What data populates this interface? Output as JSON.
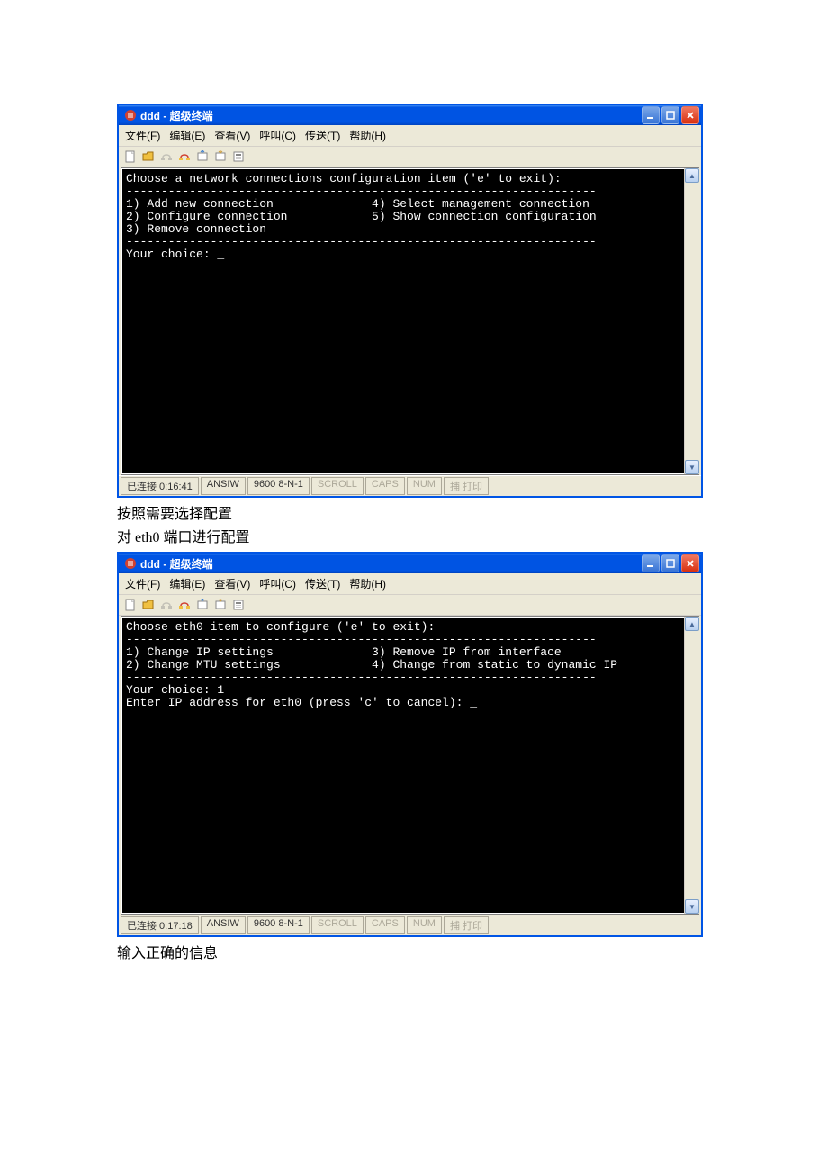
{
  "window1": {
    "title": "ddd - 超级终端",
    "menu": {
      "file": "文件(F)",
      "edit": "编辑(E)",
      "view": "查看(V)",
      "call": "呼叫(C)",
      "transfer": "传送(T)",
      "help": "帮助(H)"
    },
    "terminal": {
      "header": "Choose a network connections configuration item ('e' to exit):",
      "divider1": "-------------------------------------------------------------------",
      "opt1": "1) Add new connection              4) Select management connection",
      "opt2": "2) Configure connection            5) Show connection configuration",
      "opt3": "3) Remove connection",
      "divider2": "-------------------------------------------------------------------",
      "prompt": "Your choice: _"
    },
    "status": {
      "conn": "已连接 0:16:41",
      "term": "ANSIW",
      "params": "9600 8-N-1",
      "scroll": "SCROLL",
      "caps": "CAPS",
      "num": "NUM",
      "print": "捕  打印"
    }
  },
  "caption1": "按照需要选择配置",
  "caption2": "对 eth0 端口进行配置",
  "window2": {
    "title": "ddd - 超级终端",
    "menu": {
      "file": "文件(F)",
      "edit": "编辑(E)",
      "view": "查看(V)",
      "call": "呼叫(C)",
      "transfer": "传送(T)",
      "help": "帮助(H)"
    },
    "terminal": {
      "header": "Choose eth0 item to configure ('e' to exit):",
      "divider1": "-------------------------------------------------------------------",
      "opt1": "1) Change IP settings              3) Remove IP from interface",
      "opt2": "2) Change MTU settings             4) Change from static to dynamic IP",
      "divider2": "-------------------------------------------------------------------",
      "choice": "Your choice: 1",
      "prompt": "Enter IP address for eth0 (press 'c' to cancel): _"
    },
    "status": {
      "conn": "已连接 0:17:18",
      "term": "ANSIW",
      "params": "9600 8-N-1",
      "scroll": "SCROLL",
      "caps": "CAPS",
      "num": "NUM",
      "print": "捕  打印"
    }
  },
  "caption3": "输入正确的信息"
}
